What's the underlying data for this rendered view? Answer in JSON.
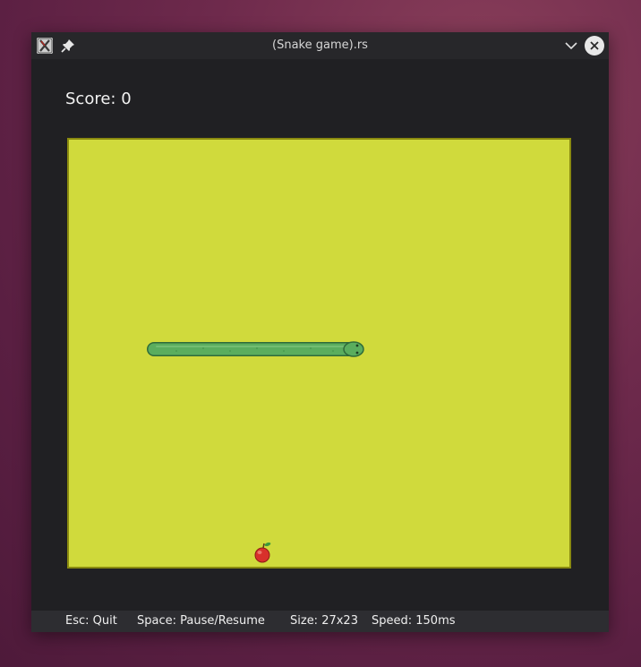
{
  "window": {
    "title": "(Snake game).rs"
  },
  "game": {
    "score_label": "Score: 0",
    "score": 0,
    "board_color": "#d0da3c",
    "snake_color": "#5aad5e",
    "food": "apple-icon"
  },
  "status_bar": {
    "items": [
      "Esc: Quit",
      "Space: Pause/Resume",
      "Size: 27x23",
      "Speed: 150ms"
    ]
  },
  "icons": {
    "app": "app-icon",
    "pin": "pin-icon",
    "minimize": "chevron-down-icon",
    "close": "close-icon"
  }
}
